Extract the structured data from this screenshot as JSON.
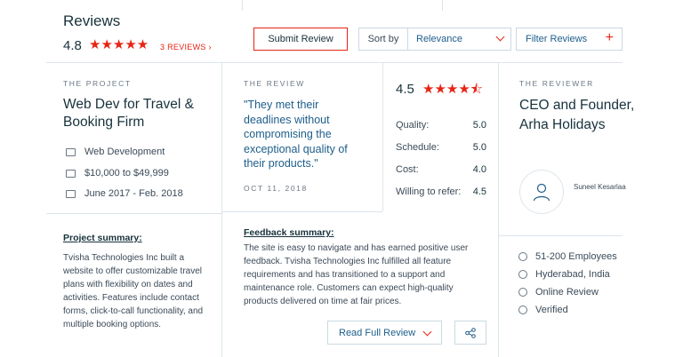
{
  "header": {
    "title": "Reviews",
    "rating": "4.8",
    "stars": "★★★★★",
    "reviews_link": "3 REVIEWS  ›",
    "submit_label": "Submit Review",
    "sort_label": "Sort by",
    "sort_value": "Relevance",
    "filter_label": "Filter Reviews",
    "filter_plus": "+"
  },
  "project": {
    "section_label": "THE PROJECT",
    "name": "Web Dev for Travel & Booking Firm",
    "category": "Web Development",
    "budget": "$10,000 to $49,999",
    "dates": "June 2017 - Feb. 2018",
    "summary_title": "Project summary:",
    "summary_text": "Tvisha Technologies Inc built a website to offer customizable travel plans with flexibility on dates and activities. Features include contact forms, click-to-call functionality, and multiple booking options."
  },
  "review": {
    "section_label": "THE REVIEW",
    "quote": "\"They met their deadlines without compromising the exceptional quality of their products.\"",
    "date": "OCT 11, 2018",
    "overall": "4.5",
    "overall_stars": "★★★★⯪",
    "scores": [
      {
        "label": "Quality:",
        "value": "5.0"
      },
      {
        "label": "Schedule:",
        "value": "5.0"
      },
      {
        "label": "Cost:",
        "value": "4.0"
      },
      {
        "label": "Willing to refer:",
        "value": "4.5"
      }
    ],
    "feedback_title": "Feedback summary:",
    "feedback_text": "The site is easy to navigate and has earned positive user feedback. Tvisha Technologies Inc fulfilled all feature requirements and has transitioned to a support and maintenance role. Customers can expect high-quality products delivered on time at fair prices.",
    "read_full_label": "Read Full Review"
  },
  "reviewer": {
    "section_label": "THE REVIEWER",
    "title": "CEO and Founder, Arha Holidays",
    "name": "Suneel Kesarlaa",
    "employees": "51-200 Employees",
    "location": "Hyderabad, India",
    "review_type": "Online Review",
    "verified": "Verified"
  },
  "colors": {
    "accent": "#e62415",
    "link": "#1d5d8a",
    "text": "#17313b",
    "border": "#dde5ea"
  }
}
